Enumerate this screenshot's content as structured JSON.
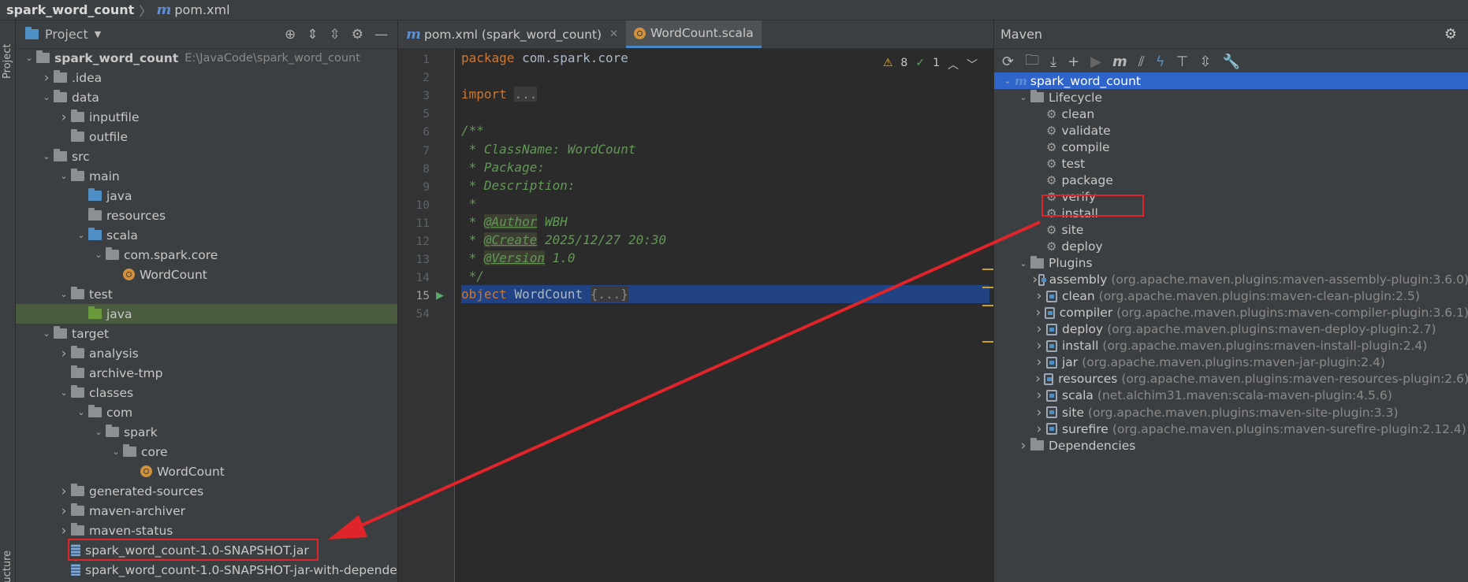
{
  "breadcrumb": {
    "project": "spark_word_count",
    "file": "pom.xml"
  },
  "left_strip": {
    "project_label": "Project",
    "structure_label": "ructure"
  },
  "project_panel": {
    "title": "Project",
    "tree": [
      {
        "label": "spark_word_count",
        "path": "E:\\JavaCode\\spark_word_count",
        "depth": 0,
        "expanded": true,
        "icon": "module-folder"
      },
      {
        "label": ".idea",
        "depth": 1,
        "expanded": false,
        "icon": "folder"
      },
      {
        "label": "data",
        "depth": 1,
        "expanded": true,
        "icon": "folder"
      },
      {
        "label": "inputfile",
        "depth": 2,
        "expanded": false,
        "icon": "folder"
      },
      {
        "label": "outfile",
        "depth": 2,
        "expanded": null,
        "icon": "folder"
      },
      {
        "label": "src",
        "depth": 1,
        "expanded": true,
        "icon": "folder"
      },
      {
        "label": "main",
        "depth": 2,
        "expanded": true,
        "icon": "folder"
      },
      {
        "label": "java",
        "depth": 3,
        "expanded": null,
        "icon": "source-folder"
      },
      {
        "label": "resources",
        "depth": 3,
        "expanded": null,
        "icon": "resources-folder"
      },
      {
        "label": "scala",
        "depth": 3,
        "expanded": true,
        "icon": "source-folder"
      },
      {
        "label": "com.spark.core",
        "depth": 4,
        "expanded": true,
        "icon": "package"
      },
      {
        "label": "WordCount",
        "depth": 5,
        "expanded": null,
        "icon": "scala-object"
      },
      {
        "label": "test",
        "depth": 2,
        "expanded": true,
        "icon": "folder"
      },
      {
        "label": "java",
        "depth": 3,
        "expanded": null,
        "icon": "test-folder",
        "selected": true
      },
      {
        "label": "target",
        "depth": 1,
        "expanded": true,
        "icon": "folder"
      },
      {
        "label": "analysis",
        "depth": 2,
        "expanded": false,
        "icon": "folder"
      },
      {
        "label": "archive-tmp",
        "depth": 2,
        "expanded": null,
        "icon": "folder"
      },
      {
        "label": "classes",
        "depth": 2,
        "expanded": true,
        "icon": "folder"
      },
      {
        "label": "com",
        "depth": 3,
        "expanded": true,
        "icon": "folder"
      },
      {
        "label": "spark",
        "depth": 4,
        "expanded": true,
        "icon": "folder"
      },
      {
        "label": "core",
        "depth": 5,
        "expanded": true,
        "icon": "folder"
      },
      {
        "label": "WordCount",
        "depth": 6,
        "expanded": null,
        "icon": "scala-object"
      },
      {
        "label": "generated-sources",
        "depth": 2,
        "expanded": false,
        "icon": "folder"
      },
      {
        "label": "maven-archiver",
        "depth": 2,
        "expanded": false,
        "icon": "folder"
      },
      {
        "label": "maven-status",
        "depth": 2,
        "expanded": false,
        "icon": "folder"
      },
      {
        "label": "spark_word_count-1.0-SNAPSHOT.jar",
        "depth": 2,
        "expanded": null,
        "icon": "jar",
        "highlighted": true
      },
      {
        "label": "spark_word_count-1.0-SNAPSHOT-jar-with-depende",
        "depth": 2,
        "expanded": null,
        "icon": "jar"
      }
    ]
  },
  "editor": {
    "tabs": [
      {
        "label": "pom.xml (spark_word_count)",
        "icon": "maven-icon",
        "active": false
      },
      {
        "label": "WordCount.scala",
        "icon": "scala-object",
        "active": true
      }
    ],
    "inspections": {
      "warnings": "8",
      "ok": "1"
    },
    "lines": [
      {
        "num": "1",
        "text": "package com.spark.core"
      },
      {
        "num": "2",
        "text": ""
      },
      {
        "num": "3",
        "text": "import ..."
      },
      {
        "num": "5",
        "text": ""
      },
      {
        "num": "6",
        "text": "/**"
      },
      {
        "num": "7",
        "text": " * ClassName: WordCount"
      },
      {
        "num": "8",
        "text": " * Package:"
      },
      {
        "num": "9",
        "text": " * Description:"
      },
      {
        "num": "10",
        "text": " *"
      },
      {
        "num": "11",
        "text": " * @Author WBH"
      },
      {
        "num": "12",
        "text": " * @Create 2025/12/27 20:30"
      },
      {
        "num": "13",
        "text": " * @Version 1.0"
      },
      {
        "num": "14",
        "text": " */"
      },
      {
        "num": "15",
        "text": "object WordCount {...}"
      },
      {
        "num": "54",
        "text": ""
      }
    ]
  },
  "maven": {
    "title": "Maven",
    "project": "spark_word_count",
    "lifecycle_label": "Lifecycle",
    "lifecycle": [
      "clean",
      "validate",
      "compile",
      "test",
      "package",
      "verify",
      "install",
      "site",
      "deploy"
    ],
    "plugins_label": "Plugins",
    "plugins": [
      {
        "name": "assembly",
        "coord": "(org.apache.maven.plugins:maven-assembly-plugin:3.6.0)"
      },
      {
        "name": "clean",
        "coord": "(org.apache.maven.plugins:maven-clean-plugin:2.5)"
      },
      {
        "name": "compiler",
        "coord": "(org.apache.maven.plugins:maven-compiler-plugin:3.6.1)"
      },
      {
        "name": "deploy",
        "coord": "(org.apache.maven.plugins:maven-deploy-plugin:2.7)"
      },
      {
        "name": "install",
        "coord": "(org.apache.maven.plugins:maven-install-plugin:2.4)"
      },
      {
        "name": "jar",
        "coord": "(org.apache.maven.plugins:maven-jar-plugin:2.4)"
      },
      {
        "name": "resources",
        "coord": "(org.apache.maven.plugins:maven-resources-plugin:2.6)"
      },
      {
        "name": "scala",
        "coord": "(net.alchim31.maven:scala-maven-plugin:4.5.6)"
      },
      {
        "name": "site",
        "coord": "(org.apache.maven.plugins:maven-site-plugin:3.3)"
      },
      {
        "name": "surefire",
        "coord": "(org.apache.maven.plugins:maven-surefire-plugin:2.12.4)"
      }
    ],
    "dependencies_label": "Dependencies"
  },
  "colors": {
    "accent": "#2f65ca",
    "annotation": "#e0252a",
    "selection_green": "#4b5b3f"
  }
}
